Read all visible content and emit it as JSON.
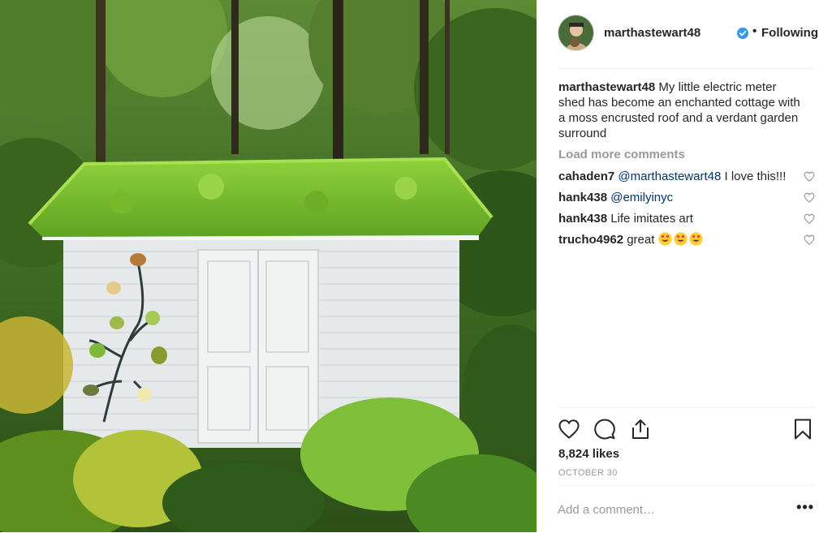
{
  "post": {
    "username": "marthastewart48",
    "follow_status": "Following",
    "separator": "•",
    "caption": "My little electric meter shed has become an enchanted cottage with a moss encrusted roof and a verdant garden surround",
    "load_more": "Load more comments",
    "likes": "8,824 likes",
    "date": "OCTOBER 30",
    "add_comment_placeholder": "Add a comment…",
    "more_options": "•••"
  },
  "comments": [
    {
      "user": "cahaden7",
      "mention": "@marthastewart48",
      "text": " I love this!!!"
    },
    {
      "user": "hank438",
      "mention": "@emilyinyc",
      "text": ""
    },
    {
      "user": "hank438",
      "mention": "",
      "text": "Life imitates art"
    },
    {
      "user": "trucho4962",
      "mention": "",
      "text": "great"
    }
  ],
  "icons": {
    "verified": "verified-badge-icon",
    "like": "heart-outline-icon",
    "comment": "comment-bubble-icon",
    "share": "share-upload-icon",
    "save": "bookmark-icon",
    "emoji": "heart-eyes-emoji"
  },
  "colors": {
    "text": "#262626",
    "muted": "#999999",
    "mention": "#003569",
    "verified": "#3897f0",
    "divider": "#efefef"
  }
}
